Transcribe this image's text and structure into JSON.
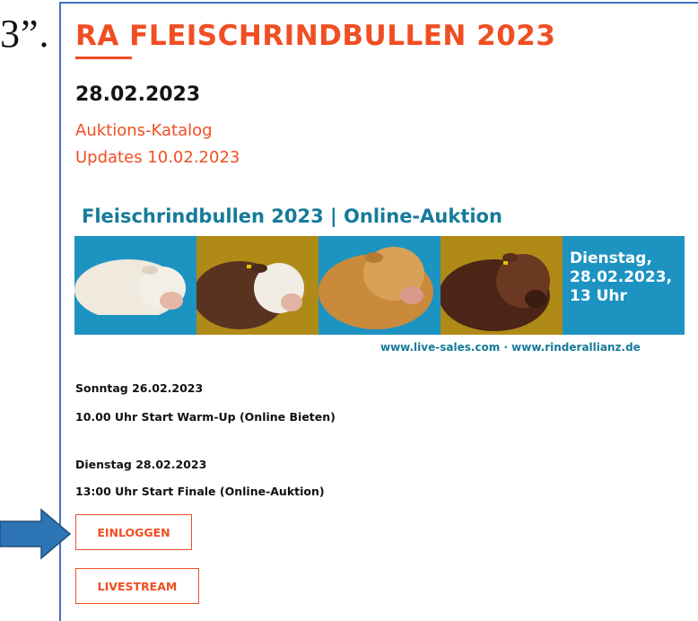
{
  "edge_text": "3”.",
  "page": {
    "title": "RA FLEISCHRINDBULLEN 2023",
    "date": "28.02.2023",
    "links": [
      "Auktions-Katalog",
      "Updates 10.02.2023"
    ]
  },
  "banner": {
    "heading": "Fleischrindbullen 2023 | Online-Auktion",
    "info_lines": [
      "Dienstag,",
      "28.02.2023,",
      "13 Uhr"
    ],
    "url": "www.live-sales.com · www.rinderallianz.de",
    "colors": {
      "blue": "#1d93c2",
      "gold": "#b08a17",
      "heading": "#167b9a"
    }
  },
  "schedule": [
    {
      "day": "Sonntag 26.02.2023",
      "event": "10.00 Uhr Start Warm-Up (Online Bieten)"
    },
    {
      "day": "Dienstag 28.02.2023",
      "event": "13:00 Uhr Start Finale (Online-Auktion)"
    }
  ],
  "buttons": {
    "login": "EINLOGGEN",
    "livestream": "LIVESTREAM"
  },
  "colors": {
    "accent": "#f04e23",
    "frame": "#4472c4",
    "arrow": "#2e75b6"
  }
}
